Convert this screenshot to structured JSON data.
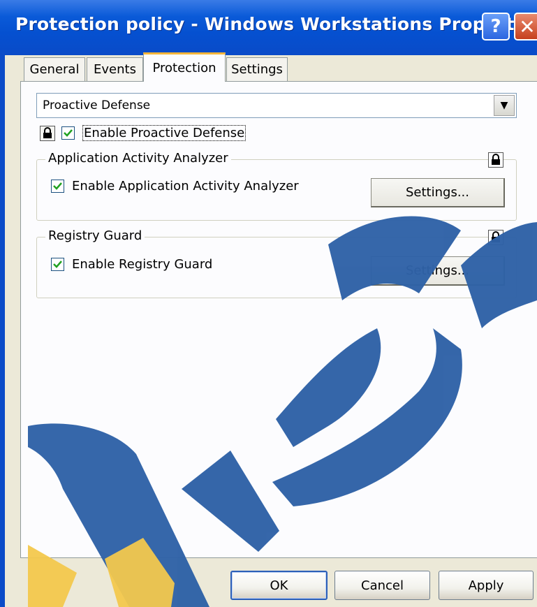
{
  "window": {
    "title": "Protection policy - Windows Workstations Properties",
    "help_glyph": "?",
    "close_glyph": "✕"
  },
  "tabs": [
    {
      "label": "General",
      "active": false
    },
    {
      "label": "Events",
      "active": false
    },
    {
      "label": "Protection",
      "active": true
    },
    {
      "label": "Settings",
      "active": false
    }
  ],
  "protection": {
    "component_dropdown": {
      "value": "Proactive Defense",
      "arrow_glyph": "▼"
    },
    "enable_proactive": {
      "label": "Enable Proactive Defense",
      "checked": true,
      "locked": true
    },
    "groups": {
      "app_activity": {
        "title": "Application Activity Analyzer",
        "checkbox_label": "Enable Application Activity Analyzer",
        "checked": true,
        "locked": true,
        "settings_label": "Settings..."
      },
      "registry_guard": {
        "title": "Registry Guard",
        "checkbox_label": "Enable Registry Guard",
        "checked": true,
        "locked": true,
        "settings_label": "Settings..."
      }
    }
  },
  "footer": {
    "ok_label": "OK",
    "cancel_label": "Cancel",
    "apply_label": "Apply"
  },
  "colors": {
    "titlebar_blue": "#0a5ad8",
    "tab_highlight": "#f5b53a",
    "watermark_blue": "#2f62a7",
    "watermark_gold": "#f3c84d"
  }
}
